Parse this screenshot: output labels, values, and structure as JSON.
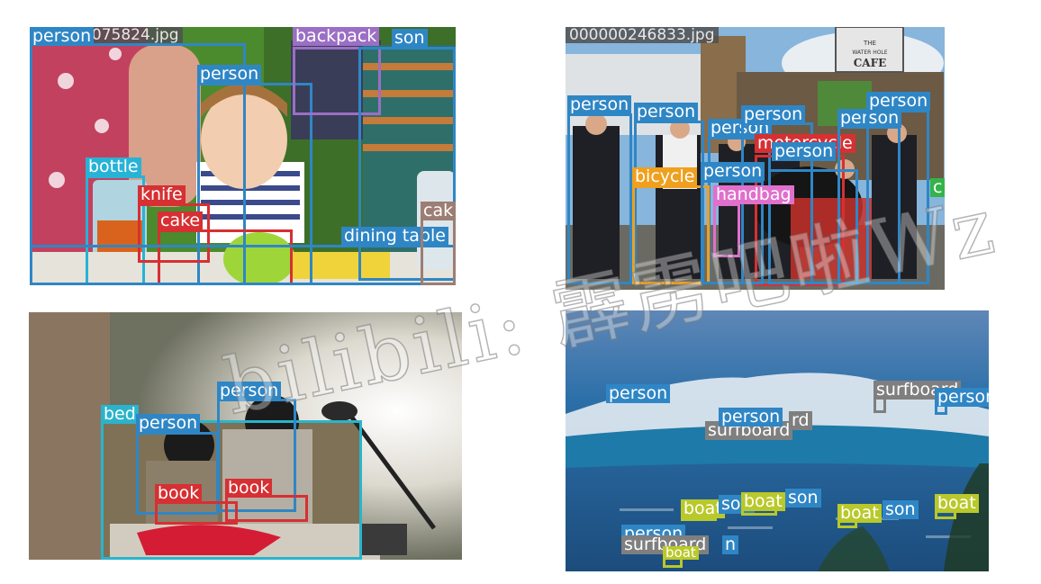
{
  "colors": {
    "person": "#2f86c5",
    "backpack": "#9b6fc4",
    "bottle": "#27b3d6",
    "knife": "#d63033",
    "cake": "#d63033",
    "cake_right": "#9c7e74",
    "dining_table": "#2f86c5",
    "motorcycle": "#d63033",
    "bicycle": "#f0a01e",
    "handbag": "#e070cc",
    "green_tag": "#34b34a",
    "bed": "#2ab4cc",
    "book": "#d63033",
    "surfboard": "#7f7f7f",
    "boat": "#b9c82a"
  },
  "panels": [
    {
      "id": "kid-kitchen",
      "filename": "000000075824.jpg",
      "scene": "kid-kitchen-scene",
      "detections": [
        {
          "label": "person",
          "class": "person"
        },
        {
          "label": "person",
          "class": "person"
        },
        {
          "label": "backpack",
          "class": "backpack"
        },
        {
          "label": "son",
          "class": "person"
        },
        {
          "label": "bottle",
          "class": "bottle"
        },
        {
          "label": "knife",
          "class": "knife"
        },
        {
          "label": "cake",
          "class": "cake"
        },
        {
          "label": "dining table",
          "class": "dining_table"
        },
        {
          "label": "cak",
          "class": "cake_right"
        }
      ]
    },
    {
      "id": "cafe-group",
      "filename": "000000246833.jpg",
      "scene": "cafe-group-scene",
      "sign_text": [
        "THE",
        "WATER HOLE",
        "CAFE"
      ],
      "detections": [
        {
          "label": "person",
          "class": "person"
        },
        {
          "label": "person",
          "class": "person"
        },
        {
          "label": "person",
          "class": "person"
        },
        {
          "label": "person",
          "class": "person"
        },
        {
          "label": "motorcycle",
          "class": "motorcycle"
        },
        {
          "label": "bicycle",
          "class": "bicycle"
        },
        {
          "label": "person",
          "class": "person"
        },
        {
          "label": "person",
          "class": "person"
        },
        {
          "label": "handbag",
          "class": "handbag"
        },
        {
          "label": "person",
          "class": "person"
        },
        {
          "label": "person",
          "class": "person"
        },
        {
          "label": "c",
          "class": "green_tag"
        }
      ]
    },
    {
      "id": "kids-reading",
      "scene": "kids-reading-scene",
      "detections": [
        {
          "label": "bed",
          "class": "bed"
        },
        {
          "label": "person",
          "class": "person"
        },
        {
          "label": "person",
          "class": "person"
        },
        {
          "label": "book",
          "class": "book"
        },
        {
          "label": "book",
          "class": "book"
        }
      ]
    },
    {
      "id": "surf-wave",
      "scene": "surf-wave-scene",
      "detections": [
        {
          "label": "person",
          "class": "person"
        },
        {
          "label": "surfboard",
          "class": "surfboard"
        },
        {
          "label": "person",
          "class": "person"
        },
        {
          "label": "surfboard",
          "class": "surfboard"
        },
        {
          "label": "rd",
          "class": "surfboard"
        },
        {
          "label": "person",
          "class": "person"
        },
        {
          "label": "boat",
          "class": "boat"
        },
        {
          "label": "son",
          "class": "person"
        },
        {
          "label": "boat",
          "class": "boat"
        },
        {
          "label": "son",
          "class": "person"
        },
        {
          "label": "boat",
          "class": "boat"
        },
        {
          "label": "son",
          "class": "person"
        },
        {
          "label": "boat",
          "class": "boat"
        },
        {
          "label": "person",
          "class": "person"
        },
        {
          "label": "surfboard",
          "class": "surfboard"
        },
        {
          "label": "n",
          "class": "person"
        },
        {
          "label": "boat",
          "class": "boat"
        }
      ]
    }
  ],
  "watermark": "bilibili: 霹雳吧啦Wz"
}
